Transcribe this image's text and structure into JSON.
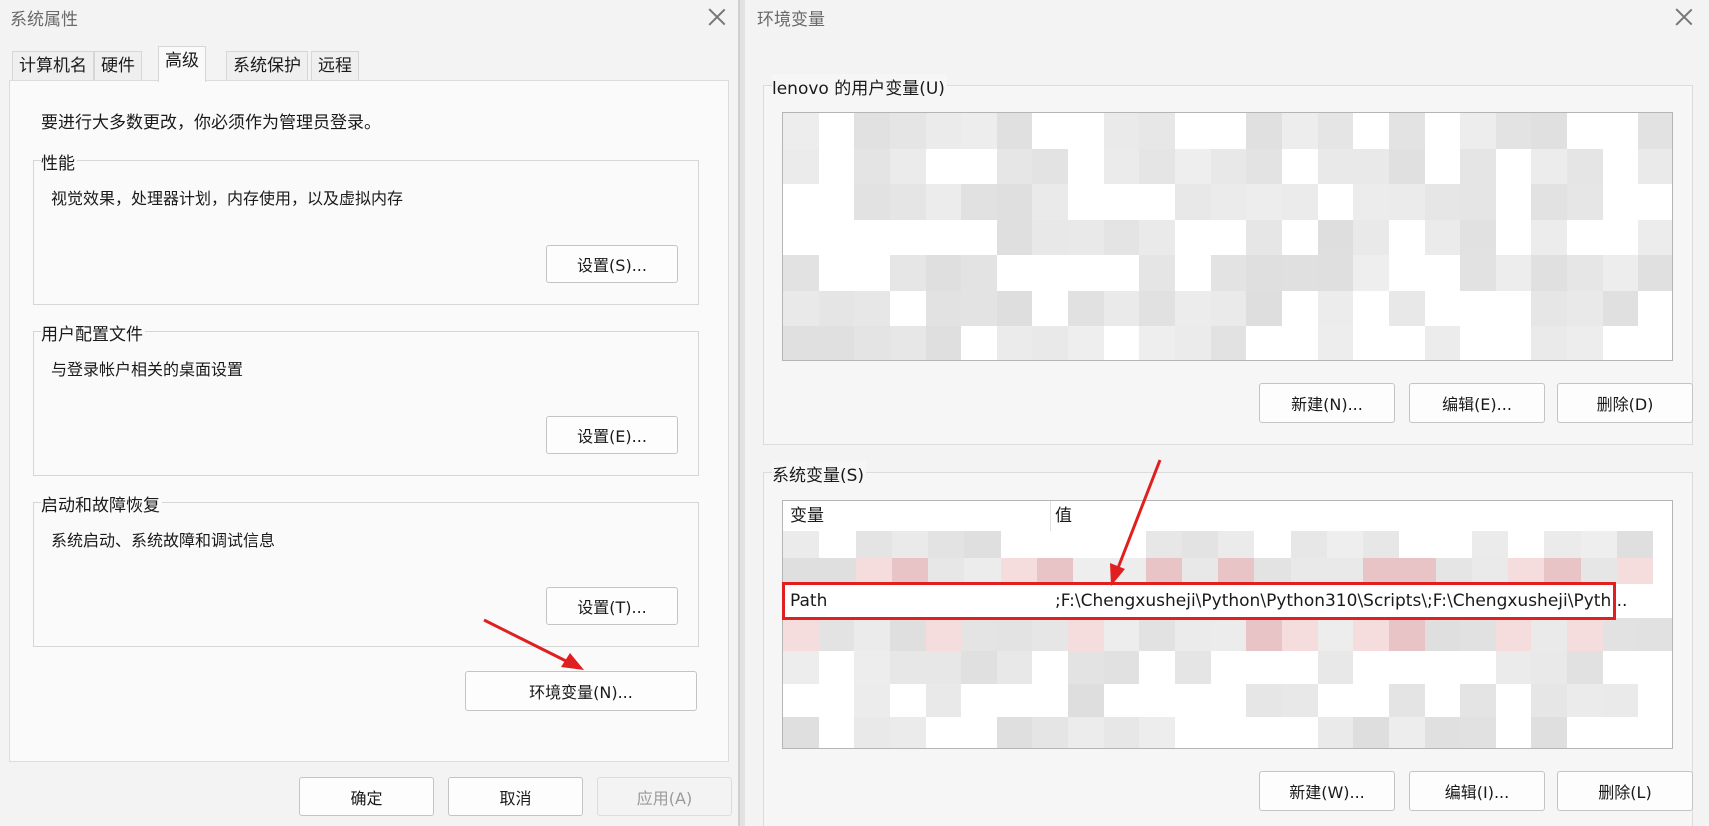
{
  "system_properties": {
    "title": "系统属性",
    "tabs": [
      {
        "label": "计算机名"
      },
      {
        "label": "硬件"
      },
      {
        "label": "高级"
      },
      {
        "label": "系统保护"
      },
      {
        "label": "远程"
      }
    ],
    "admin_notice": "要进行大多数更改，你必须作为管理员登录。",
    "performance": {
      "title": "性能",
      "description": "视觉效果，处理器计划，内存使用，以及虚拟内存",
      "button": "设置(S)..."
    },
    "user_profile": {
      "title": "用户配置文件",
      "description": "与登录帐户相关的桌面设置",
      "button": "设置(E)..."
    },
    "startup_recovery": {
      "title": "启动和故障恢复",
      "description": "系统启动、系统故障和调试信息",
      "button": "设置(T)..."
    },
    "env_button": "环境变量(N)...",
    "footer": {
      "ok": "确定",
      "cancel": "取消",
      "apply": "应用(A)"
    }
  },
  "environment_variables": {
    "title": "环境变量",
    "user_section": {
      "title": "lenovo 的用户变量(U)",
      "buttons": {
        "new": "新建(N)...",
        "edit": "编辑(E)...",
        "delete": "删除(D)"
      }
    },
    "system_section": {
      "title": "系统变量(S)",
      "columns": {
        "name": "变量",
        "value": "值"
      },
      "selected_row": {
        "name": "Path",
        "value": ";F:\\Chengxusheji\\Python\\Python310\\Scripts\\;F:\\Chengxusheji\\Pyth..."
      },
      "buttons": {
        "new": "新建(W)...",
        "edit": "编辑(I)...",
        "delete": "删除(L)"
      }
    }
  },
  "colors": {
    "annotation_red": "#e02020"
  },
  "icons": [
    "close-icon"
  ]
}
